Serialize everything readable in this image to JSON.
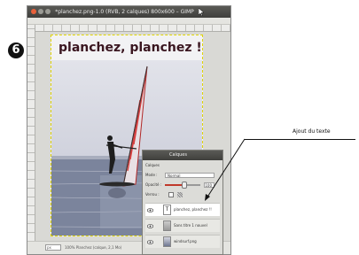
{
  "window": {
    "title": "*planchez.png-1.0 (RVB, 2 calques) 800x600 – GIMP"
  },
  "canvas": {
    "headline": "planchez, planchez !!"
  },
  "statusbar": {
    "zoom": "px",
    "info": "100% Planchez (calque, 2,1 Mo)"
  },
  "step": {
    "number": "6"
  },
  "layers": {
    "title": "Calques",
    "tab_label": "Calques",
    "mode_label": "Mode :",
    "mode_value": "Normal",
    "opacity_label": "Opacité :",
    "opacity_value": "100",
    "opacity_percent": 100,
    "lock_label": "Verrou :",
    "items": [
      {
        "name": "planchez, planchez !!",
        "thumb": "T",
        "type": "text",
        "active": true
      },
      {
        "name": "Sans titre 1 nouvel",
        "thumb": "",
        "type": "image",
        "active": false
      },
      {
        "name": "windsurf.png",
        "thumb": "",
        "type": "image",
        "active": false
      }
    ]
  },
  "annotation": {
    "label": "Ajout du texte"
  },
  "colors": {
    "headline": "#3a1620",
    "selection_border": "#e0d400",
    "sail": "#d64040",
    "water": "#6e7790"
  }
}
